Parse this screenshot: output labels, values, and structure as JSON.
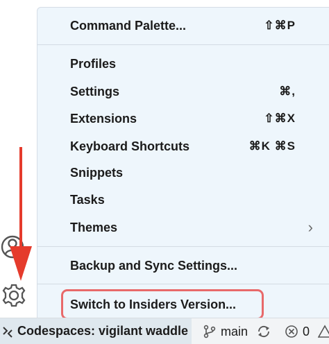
{
  "menu": {
    "command_palette": {
      "label": "Command Palette...",
      "shortcut": "⇧⌘P"
    },
    "profiles": {
      "label": "Profiles"
    },
    "settings": {
      "label": "Settings",
      "shortcut": "⌘,"
    },
    "extensions": {
      "label": "Extensions",
      "shortcut": "⇧⌘X"
    },
    "keyboard_shortcuts": {
      "label": "Keyboard Shortcuts",
      "shortcut": "⌘K ⌘S"
    },
    "snippets": {
      "label": "Snippets"
    },
    "tasks": {
      "label": "Tasks"
    },
    "themes": {
      "label": "Themes",
      "chevron": "›"
    },
    "backup_sync": {
      "label": "Backup and Sync Settings..."
    },
    "switch_insiders": {
      "label": "Switch to Insiders Version..."
    }
  },
  "status_bar": {
    "remote_label": "Codespaces: vigilant waddle",
    "branch": "main",
    "errors": "0"
  },
  "colors": {
    "menu_background": "#eef6fc",
    "highlight_border": "#e8696a",
    "arrow": "#e53b2c",
    "remote_background": "#dfe8ee"
  },
  "icons": [
    "account-icon",
    "gear-icon",
    "remote-icon",
    "branch-icon",
    "sync-icon",
    "error-icon",
    "warning-icon",
    "chevron-right-icon"
  ]
}
